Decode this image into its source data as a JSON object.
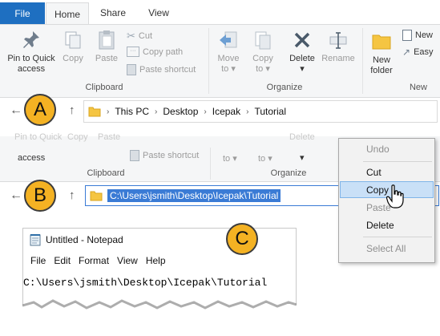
{
  "panel_a": {
    "tabs": {
      "file": "File",
      "home": "Home",
      "share": "Share",
      "view": "View"
    },
    "clipboard": {
      "pin_label_1": "Pin to Quick",
      "pin_label_2": "access",
      "copy": "Copy",
      "paste": "Paste",
      "cut": "Cut",
      "copy_path": "Copy path",
      "paste_shortcut": "Paste shortcut",
      "group_label": "Clipboard"
    },
    "organize": {
      "move_to_1": "Move",
      "move_to_2": "to",
      "copy_to_1": "Copy",
      "copy_to_2": "to",
      "delete": "Delete",
      "rename": "Rename",
      "group_label": "Organize"
    },
    "new": {
      "new_folder_1": "New",
      "new_folder_2": "folder",
      "new_item": "New",
      "easy_access": "Easy",
      "group_label": "New"
    },
    "breadcrumb": [
      "This PC",
      "Desktop",
      "Icepak",
      "Tutorial"
    ],
    "badge": "A"
  },
  "panel_b": {
    "ribbon_partial": {
      "pin_top": "Pin to Quick",
      "pin_bottom": "access",
      "copy": "Copy",
      "paste": "Paste",
      "paste_shortcut": "Paste shortcut",
      "move_to_2": "to",
      "copy_to_2": "to",
      "clipboard_label": "Clipboard",
      "organize_label": "Organize",
      "delete_top": "Delete"
    },
    "address_path": "C:\\Users\\jsmith\\Desktop\\Icepak\\Tutorial",
    "badge": "B",
    "context_menu": [
      {
        "label": "Undo",
        "enabled": false
      },
      {
        "label": "Cut",
        "enabled": true
      },
      {
        "label": "Copy",
        "enabled": true,
        "highlighted": true
      },
      {
        "label": "Paste",
        "enabled": false
      },
      {
        "label": "Delete",
        "enabled": true
      },
      {
        "label": "Select All",
        "enabled": false
      }
    ]
  },
  "panel_c": {
    "window_title": "Untitled - Notepad",
    "menu": [
      "File",
      "Edit",
      "Format",
      "View",
      "Help"
    ],
    "text": "C:\\Users\\jsmith\\Desktop\\Icepak\\Tutorial",
    "badge": "C"
  },
  "colors": {
    "file_tab": "#1e6fc1",
    "badge_fill": "#f4b223",
    "selection": "#3a7bd5",
    "menu_highlight": "#c9e0f7",
    "folder": "#f5c542"
  }
}
